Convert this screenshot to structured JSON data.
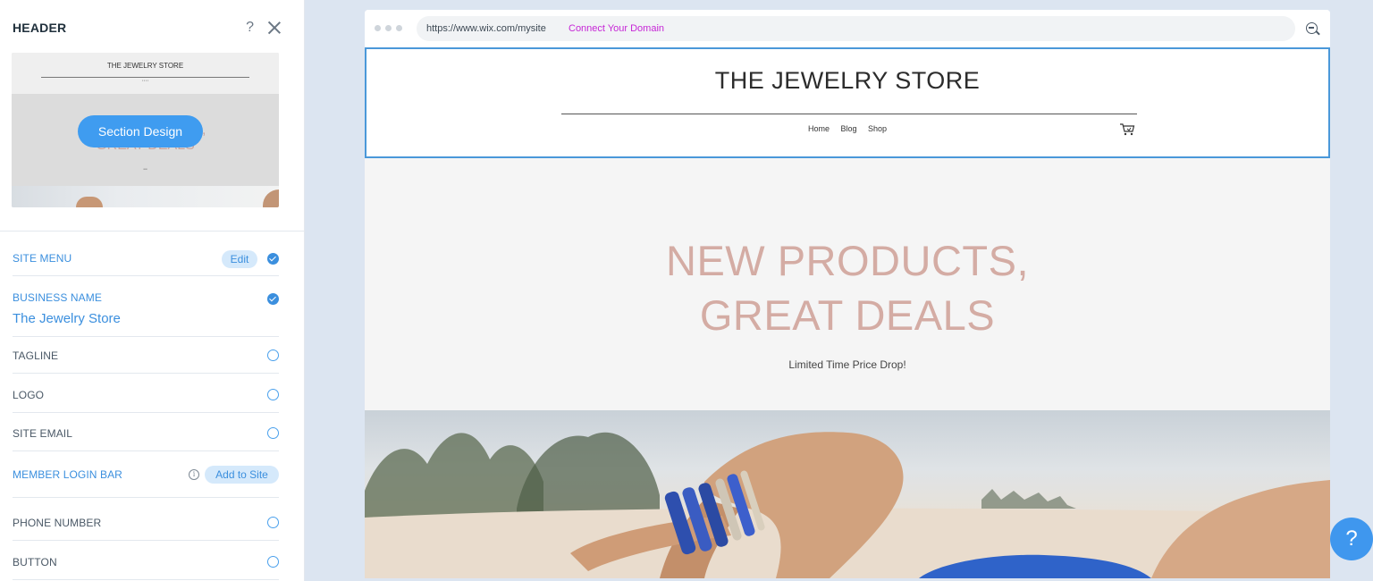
{
  "panel": {
    "title": "HEADER",
    "help_glyph": "?",
    "preview": {
      "store_name": "THE JEWELRY STORE",
      "hero_line1": "NEW PRODUCTS,",
      "hero_line2": "GREAT DEALS",
      "button_label": "Section Design"
    },
    "items": [
      {
        "label": "SITE MENU",
        "action": "Edit",
        "state": "checked"
      },
      {
        "label": "BUSINESS NAME",
        "value": "The Jewelry Store",
        "state": "checked"
      },
      {
        "label": "TAGLINE",
        "state": "unchecked"
      },
      {
        "label": "LOGO",
        "state": "unchecked"
      },
      {
        "label": "SITE EMAIL",
        "state": "unchecked"
      },
      {
        "label": "MEMBER LOGIN BAR",
        "action": "Add to Site",
        "state": "info"
      },
      {
        "label": "PHONE NUMBER",
        "state": "unchecked"
      },
      {
        "label": "BUTTON",
        "state": "unchecked"
      }
    ]
  },
  "browser": {
    "url": "https://www.wix.com/mysite",
    "domain_link": "Connect Your Domain"
  },
  "site": {
    "store_name": "THE JEWELRY STORE",
    "nav": [
      "Home",
      "Blog",
      "Shop"
    ],
    "hero_line1": "NEW PRODUCTS,",
    "hero_line2": "GREAT DEALS",
    "subtitle": "Limited Time Price Drop!"
  },
  "help_fab_glyph": "?",
  "colors": {
    "accent": "#3b8fde",
    "domain_link": "#c626d6",
    "hero_text": "#d4aca4",
    "bracelet_blue": "#2e4fae",
    "canvas_bg": "#dce5f1"
  }
}
